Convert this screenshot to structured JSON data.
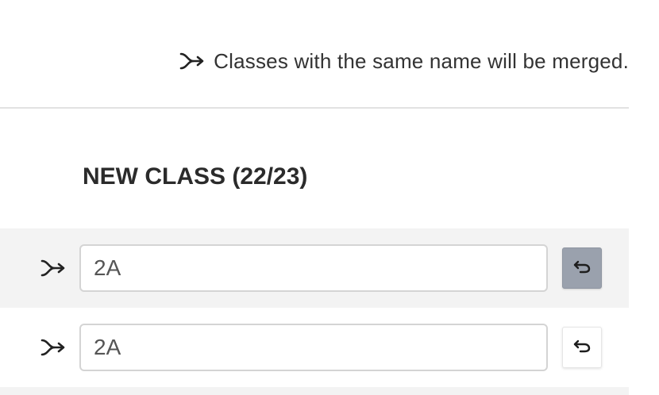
{
  "notice": {
    "icon": "merge-icon",
    "text": "Classes with the same name will be merged."
  },
  "section": {
    "title": "NEW CLASS (22/23)"
  },
  "rows": [
    {
      "value": "2A",
      "placeholder": "",
      "undo_icon": "undo-icon",
      "undo_state": "active"
    },
    {
      "value": "2A",
      "placeholder": "",
      "undo_icon": "undo-icon",
      "undo_state": "default"
    }
  ],
  "colors": {
    "row_alt_background": "#f3f3f3",
    "undo_active_background": "#9aa1ad",
    "divider": "#e2e2e2"
  }
}
